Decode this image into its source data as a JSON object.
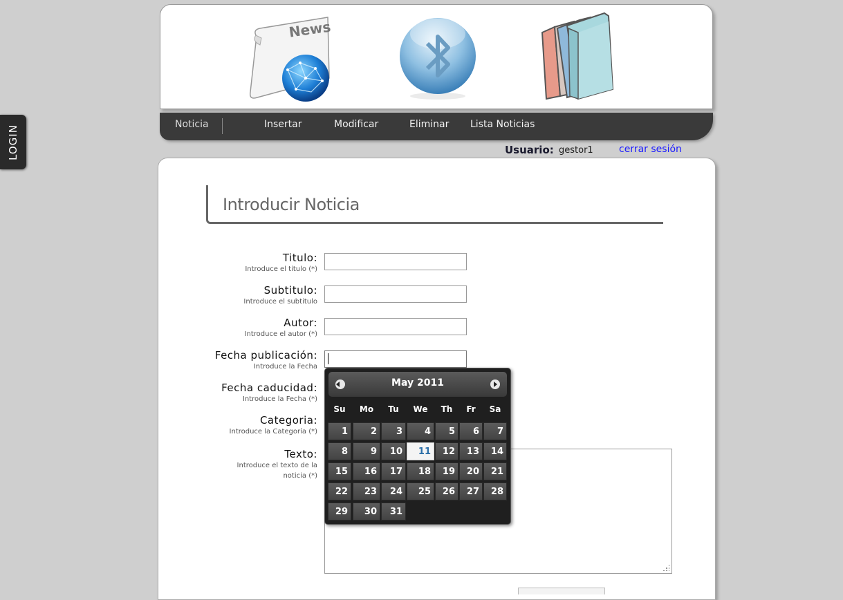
{
  "sidebar": {
    "login_label": "LOGIN"
  },
  "banner": {
    "news_icon_text": "News"
  },
  "nav": {
    "items": [
      {
        "label": "Noticia"
      },
      {
        "label": "Insertar"
      },
      {
        "label": "Modificar"
      },
      {
        "label": "Eliminar"
      },
      {
        "label": "Lista Noticias"
      }
    ]
  },
  "user": {
    "label": "Usuario:",
    "name": "gestor1",
    "logout": "cerrar sesión"
  },
  "page": {
    "title": "Introducir Noticia"
  },
  "form": {
    "fields": [
      {
        "label": "Titulo:",
        "hint": "Introduce el titulo (*)",
        "value": ""
      },
      {
        "label": "Subtitulo:",
        "hint": "Introduce el subtitulo",
        "value": ""
      },
      {
        "label": "Autor:",
        "hint": "Introduce el autor (*)",
        "value": ""
      },
      {
        "label": "Fecha publicación:",
        "hint": "Introduce la Fecha",
        "value": ""
      },
      {
        "label": "Fecha caducidad:",
        "hint": "Introduce la Fecha (*)",
        "value": ""
      },
      {
        "label": "Categoria:",
        "hint": "Introduce la Categoría (*)",
        "value": ""
      },
      {
        "label": "Texto:",
        "hint_line1": "Introduce el texto de la",
        "hint_line2": "noticia (*)",
        "value": ""
      }
    ]
  },
  "datepicker": {
    "month_year": "May 2011",
    "weekdays": [
      "Su",
      "Mo",
      "Tu",
      "We",
      "Th",
      "Fr",
      "Sa"
    ],
    "days": [
      "1",
      "2",
      "3",
      "4",
      "5",
      "6",
      "7",
      "8",
      "9",
      "10",
      "11",
      "12",
      "13",
      "14",
      "15",
      "16",
      "17",
      "18",
      "19",
      "20",
      "21",
      "22",
      "23",
      "24",
      "25",
      "26",
      "27",
      "28",
      "29",
      "30",
      "31"
    ],
    "today": "11"
  }
}
